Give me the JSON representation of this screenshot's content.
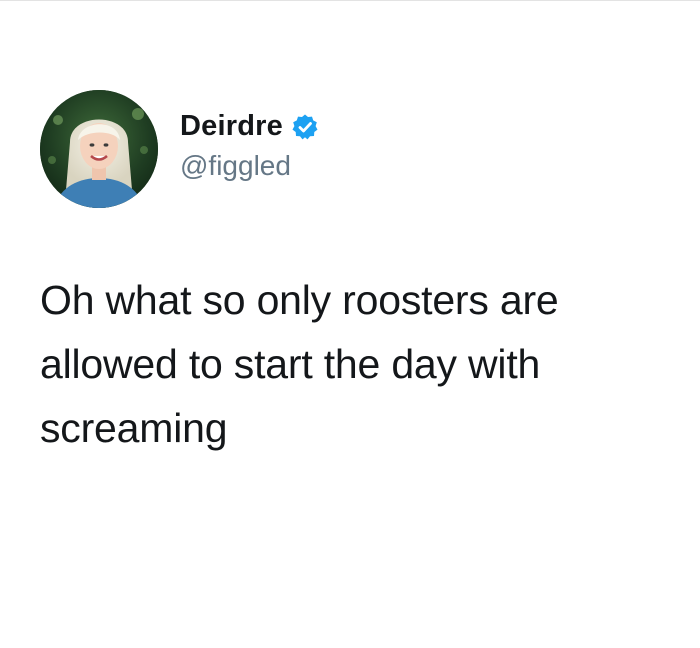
{
  "tweet": {
    "author": {
      "display_name": "Deirdre",
      "handle": "@figgled",
      "verified": true,
      "avatar_icon": "profile-photo",
      "verified_icon": "verified-badge-icon"
    },
    "text": "Oh what so only roosters are allowed to start the day with screaming"
  },
  "colors": {
    "background": "#ffffff",
    "text_primary": "#14171a",
    "text_secondary": "#657786",
    "verified_blue": "#1da1f2"
  }
}
